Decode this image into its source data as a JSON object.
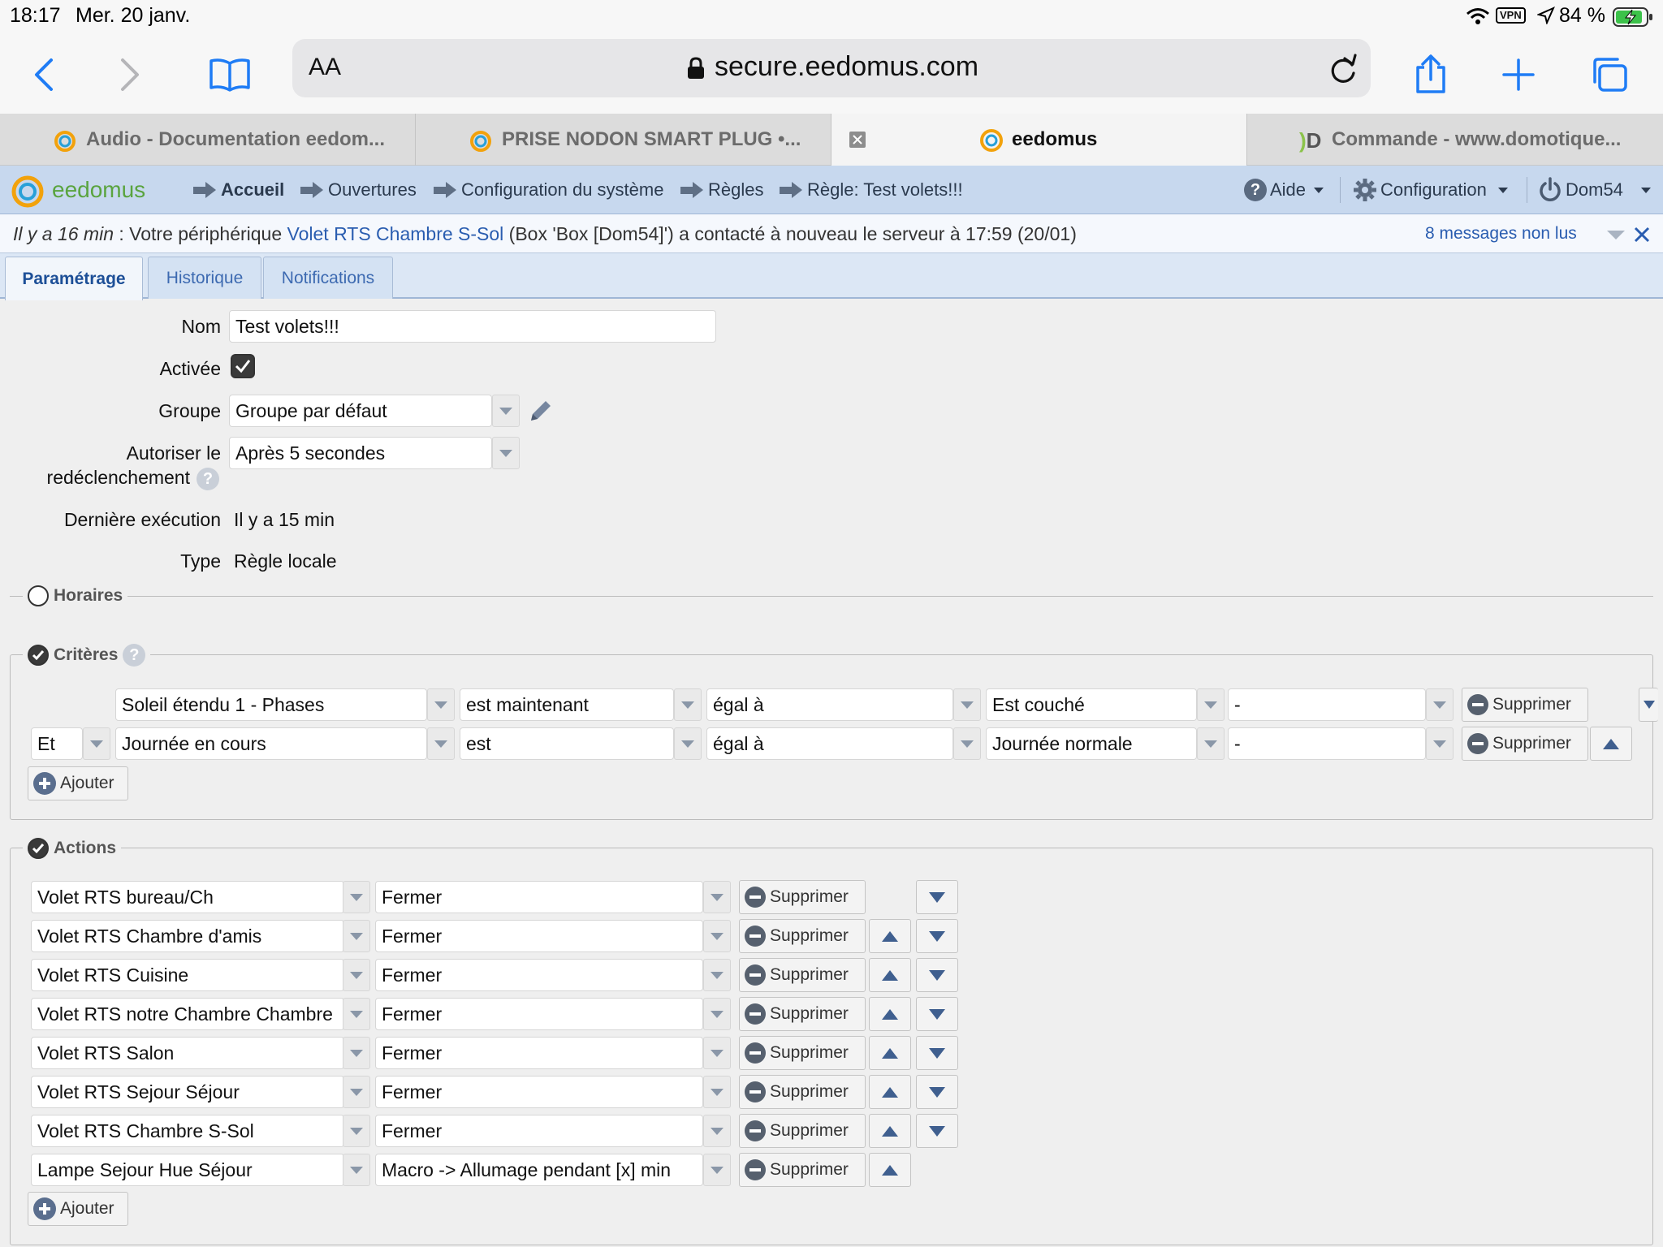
{
  "ios_status": {
    "time": "18:17",
    "date": "Mer. 20 janv.",
    "vpn": "VPN",
    "battery": "84 %"
  },
  "safari": {
    "text_size": "AA",
    "url": "secure.eedomus.com"
  },
  "browser_tabs": [
    {
      "label": "Audio - Documentation eedom...",
      "active": false
    },
    {
      "label": "PRISE NODON SMART PLUG •...",
      "active": false
    },
    {
      "label": "eedomus",
      "active": true
    },
    {
      "label": "Commande - www.domotique...",
      "active": false
    }
  ],
  "app": {
    "logo": "eedomus",
    "breadcrumb": [
      "Accueil",
      "Ouvertures",
      "Configuration du système",
      "Règles",
      "Règle: Test volets!!!"
    ],
    "menu": {
      "help": "Aide",
      "config": "Configuration",
      "user": "Dom54"
    }
  },
  "notification": {
    "time": "Il y a 16 min",
    "text_before": " : Votre périphérique ",
    "device": "Volet RTS Chambre S-Sol",
    "text_after": " (Box 'Box [Dom54]') a contacté à nouveau le serveur à 17:59 (20/01)",
    "unread": "8 messages non lus"
  },
  "page_tabs": [
    "Paramétrage",
    "Historique",
    "Notifications"
  ],
  "form": {
    "name_label": "Nom",
    "name_value": "Test volets!!!",
    "active_label": "Activée",
    "active": true,
    "group_label": "Groupe",
    "group_value": "Groupe par défaut",
    "retrigger_label_1": "Autoriser le",
    "retrigger_label_2": "redéclenchement",
    "retrigger_value": "Après 5 secondes",
    "last_exec_label": "Dernière exécution",
    "last_exec_value": "Il y a 15 min",
    "type_label": "Type",
    "type_value": "Règle locale"
  },
  "horaires": {
    "label": "Horaires",
    "checked": false
  },
  "criteres": {
    "label": "Critères",
    "checked": true,
    "rows": [
      {
        "connector": "",
        "device": "Soleil étendu 1 - Phases",
        "when": "est maintenant",
        "op": "égal à",
        "value": "Est couché",
        "extra": "-"
      },
      {
        "connector": "Et",
        "device": "Journée en cours",
        "when": "est",
        "op": "égal à",
        "value": "Journée normale",
        "extra": "-"
      }
    ],
    "delete_label": "Supprimer",
    "add_label": "Ajouter"
  },
  "actions": {
    "label": "Actions",
    "checked": true,
    "rows": [
      {
        "device": "Volet RTS bureau/Ch",
        "action": "Fermer"
      },
      {
        "device": "Volet RTS Chambre d'amis",
        "action": "Fermer"
      },
      {
        "device": "Volet RTS Cuisine",
        "action": "Fermer"
      },
      {
        "device": "Volet RTS notre Chambre Chambre",
        "action": "Fermer"
      },
      {
        "device": "Volet RTS Salon",
        "action": "Fermer"
      },
      {
        "device": "Volet RTS Sejour Séjour",
        "action": "Fermer"
      },
      {
        "device": "Volet RTS Chambre S-Sol",
        "action": "Fermer"
      },
      {
        "device": "Lampe Sejour Hue Séjour",
        "action": "Macro -> Allumage pendant [x] min"
      }
    ],
    "delete_label": "Supprimer",
    "add_label": "Ajouter"
  },
  "colors": {
    "accent_blue": "#1f7cf5",
    "link_blue": "#2a5db0",
    "header_bg": "#c7d8ee",
    "logo_green": "#6aa84f"
  }
}
